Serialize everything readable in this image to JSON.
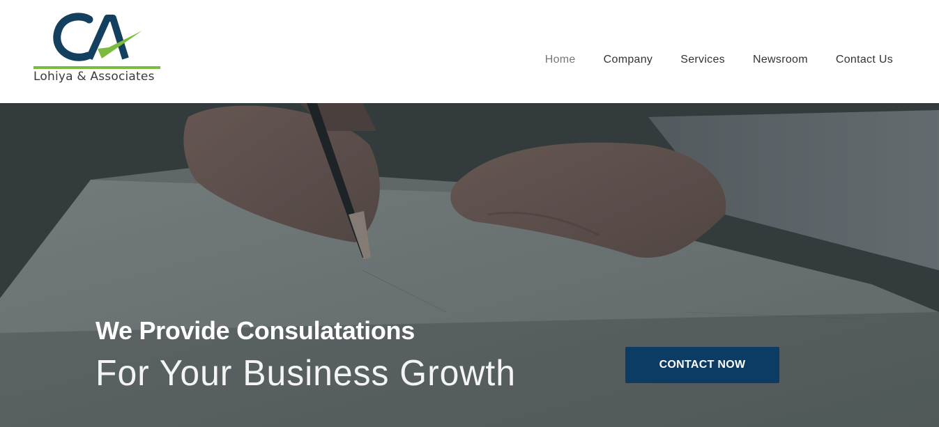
{
  "logo": {
    "text": "Lohiya & Associates",
    "mark_letters": "CA",
    "colors": {
      "primary": "#13405f",
      "accent": "#7cbb3f"
    }
  },
  "nav": {
    "items": [
      {
        "label": "Home",
        "active": true
      },
      {
        "label": "Company",
        "active": false
      },
      {
        "label": "Services",
        "active": false
      },
      {
        "label": "Newsroom",
        "active": false
      },
      {
        "label": "Contact Us",
        "active": false
      }
    ]
  },
  "hero": {
    "title": "We Provide Consulatations",
    "subtitle": "For Your Business Growth",
    "cta_label": "CONTACT NOW",
    "background_image": "hand-writing-document-photo",
    "colors": {
      "cta_bg": "#0c3b63",
      "text": "#ffffff"
    }
  }
}
